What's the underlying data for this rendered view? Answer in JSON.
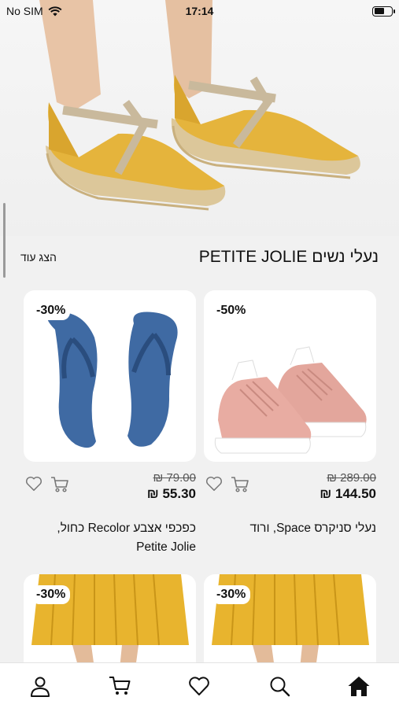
{
  "status_bar": {
    "carrier": "No SIM",
    "time": "17:14"
  },
  "section": {
    "title": "נעלי נשים PETITE JOLIE",
    "show_more": "הצג עוד"
  },
  "products": [
    {
      "discount": "-50%",
      "old_price": "₪ 289.00",
      "new_price": "₪ 144.50",
      "name": "נעלי סניקרס Space, ורוד"
    },
    {
      "discount": "-30%",
      "old_price": "₪ 79.00",
      "new_price": "₪ 55.30",
      "name": "כפכפי אצבע Recolor כחול, Petite Jolie"
    }
  ],
  "next_row": [
    {
      "discount": "-30%"
    },
    {
      "discount": "-30%"
    }
  ],
  "tab_bar": {
    "icons": [
      "user-icon",
      "cart-icon",
      "heart-icon",
      "search-icon",
      "home-icon"
    ],
    "active": "home-icon"
  }
}
